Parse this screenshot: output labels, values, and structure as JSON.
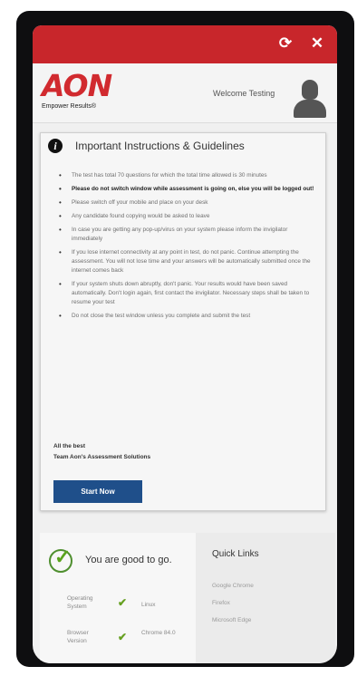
{
  "topbar": {
    "refresh_icon": "refresh-icon",
    "close_icon": "close-icon"
  },
  "header": {
    "logo_text": "AON",
    "logo_tagline": "Empower Results®",
    "welcome": "Welcome Testing"
  },
  "instructions": {
    "title": "Important Instructions & Guidelines",
    "items": [
      "The test has total 70 questions for which the total time allowed is 30 minutes",
      "Please do not switch window while assessment is going on, else you will be logged out!",
      "Please switch off your mobile and place on your desk",
      "Any candidate found copying would be asked to leave",
      "In case you are getting any pop-up/virus on your system please inform the invigilator immediately",
      "If you lose internet connectivity at any point in test, do not panic. Continue attempting the assessment. You will not lose time and your answers will be automatically submitted once the internet comes back",
      "If your system shuts down abruptly, don't panic. Your results would have been saved automatically. Don't login again, first contact the invigilator. Necessary steps shall be taken to resume your test",
      "Do not close the test window unless you complete and submit the test"
    ],
    "signoff_line1": "All the best",
    "signoff_line2": "Team Aon's Assessment Solutions",
    "start_button": "Start Now"
  },
  "status": {
    "message": "You are good to go.",
    "os_label": "Operating System",
    "os_value": "Linux",
    "browser_label": "Browser Version",
    "browser_value": "Chrome 84.0"
  },
  "quick_links": {
    "title": "Quick Links",
    "links": [
      "Google Chrome",
      "Firefox",
      "Microsoft Edge"
    ]
  },
  "colors": {
    "brand_red": "#c8262b",
    "button_blue": "#1f4f8a",
    "check_green": "#66a021"
  }
}
